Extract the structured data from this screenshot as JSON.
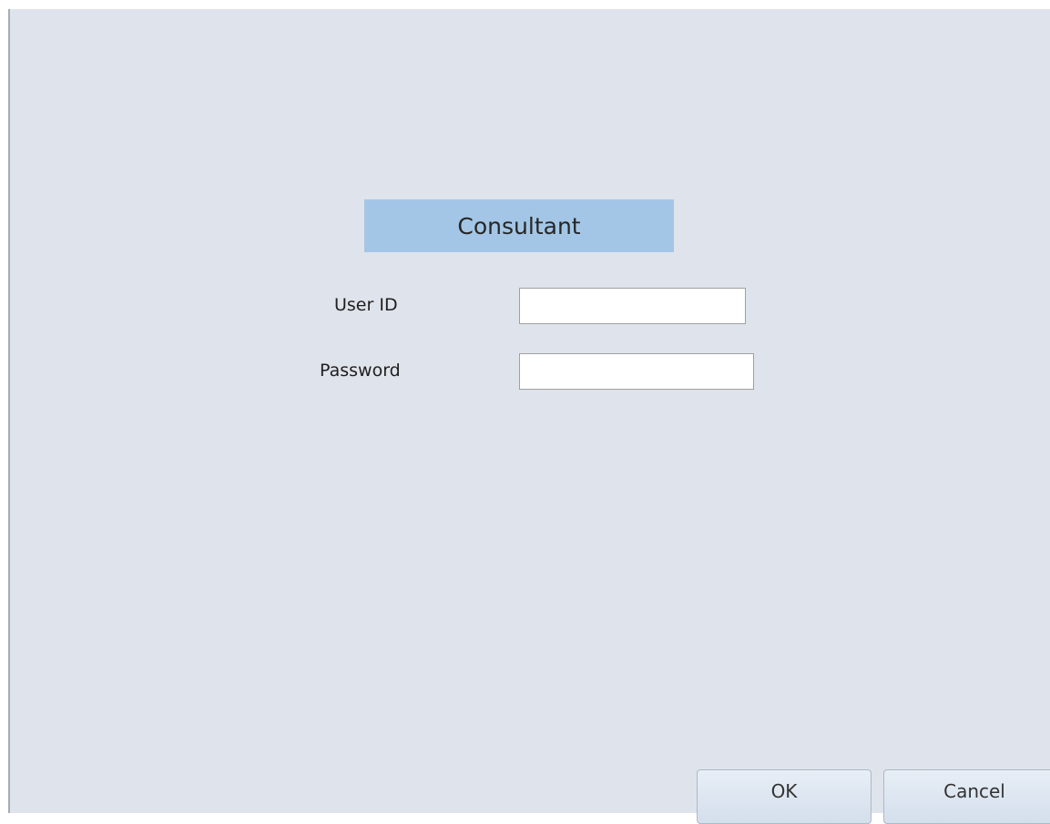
{
  "form": {
    "title": "Consultant",
    "fields": {
      "user_id": {
        "label": "User ID",
        "value": "",
        "placeholder": ""
      },
      "password": {
        "label": "Password",
        "value": "",
        "placeholder": ""
      }
    },
    "buttons": {
      "ok_label": "OK",
      "cancel_label": "Cancel"
    }
  },
  "colors": {
    "form_background": "#dfe3eb",
    "title_background": "#a4c6e6",
    "button_gradient_top": "#e7eef6",
    "button_gradient_bottom": "#d4dfec"
  }
}
